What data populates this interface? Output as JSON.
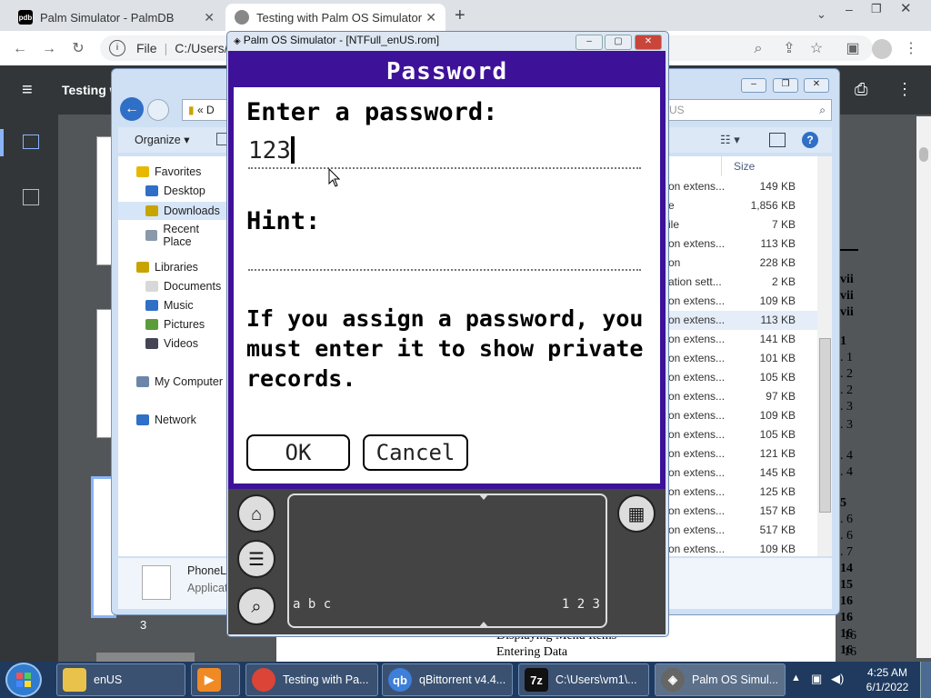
{
  "browser": {
    "tabs": [
      {
        "title": "Palm Simulator - PalmDB",
        "favicon": "pdb"
      },
      {
        "title": "Testing with Palm OS Simulator"
      }
    ],
    "address": {
      "prefix": "File",
      "url": "C:/Users/vm"
    },
    "pdf_title": "Testing w"
  },
  "pdf": {
    "toc_right": [
      "vii",
      "vii",
      "vii",
      "1",
      ". 1",
      ". 2",
      ". 2",
      ". 3",
      ". 3",
      ". 4",
      ". 4",
      "5",
      ". 6",
      ". 6",
      ". 7",
      "14",
      "15",
      "16",
      "16",
      "16",
      "16"
    ],
    "bottom_entries": [
      {
        "label": "Displaying Menu Items",
        "page": "16"
      },
      {
        "label": "Entering Data",
        "page": "16"
      }
    ],
    "thumb_page": "3"
  },
  "explorer": {
    "search_placeholder": "US",
    "crumb": "D",
    "organize": "Organize",
    "column_size": "Size",
    "nav": [
      {
        "label": "Favorites"
      },
      {
        "label": "Desktop"
      },
      {
        "label": "Downloads"
      },
      {
        "label": "Recent Place"
      },
      {
        "label": "Libraries"
      },
      {
        "label": "Documents"
      },
      {
        "label": "Music"
      },
      {
        "label": "Pictures"
      },
      {
        "label": "Videos"
      },
      {
        "label": "My Computer"
      },
      {
        "label": "Network"
      }
    ],
    "rows": [
      {
        "name": "on extens...",
        "size": "149 KB"
      },
      {
        "name": "e",
        "size": "1,856 KB"
      },
      {
        "name": "ile",
        "size": "7 KB"
      },
      {
        "name": "on extens...",
        "size": "113 KB"
      },
      {
        "name": "on",
        "size": "228 KB"
      },
      {
        "name": "ation sett...",
        "size": "2 KB"
      },
      {
        "name": "on extens...",
        "size": "109 KB"
      },
      {
        "name": "on extens...",
        "size": "113 KB"
      },
      {
        "name": "on extens...",
        "size": "141 KB"
      },
      {
        "name": "on extens...",
        "size": "101 KB"
      },
      {
        "name": "on extens...",
        "size": "105 KB"
      },
      {
        "name": "on extens...",
        "size": "97 KB"
      },
      {
        "name": "on extens...",
        "size": "109 KB"
      },
      {
        "name": "on extens...",
        "size": "105 KB"
      },
      {
        "name": "on extens...",
        "size": "121 KB"
      },
      {
        "name": "on extens...",
        "size": "145 KB"
      },
      {
        "name": "on extens...",
        "size": "125 KB"
      },
      {
        "name": "on extens...",
        "size": "157 KB"
      },
      {
        "name": "on extens...",
        "size": "517 KB"
      },
      {
        "name": "on extens...",
        "size": "109 KB"
      }
    ],
    "details": {
      "name": "PhoneL",
      "type": "Applicat"
    }
  },
  "palm": {
    "window_title": "Palm OS Simulator - [NTFull_enUS.rom]",
    "form_title": "Password",
    "prompt": "Enter a password:",
    "password_value": "123",
    "hint_label": "Hint:",
    "hint_value": "",
    "message_lines": [
      "If you assign a password, you",
      "must enter it to show private",
      "records."
    ],
    "ok": "OK",
    "cancel": "Cancel",
    "graffiti_left": "a b c",
    "graffiti_right": "1 2 3"
  },
  "taskbar": {
    "items": [
      {
        "label": "enUS"
      },
      {
        "label": ""
      },
      {
        "label": "Testing with Pa..."
      },
      {
        "label": "qBittorrent v4.4..."
      },
      {
        "label": "C:\\Users\\vm1\\..."
      },
      {
        "label": "Palm OS Simul..."
      }
    ],
    "time": "4:25 AM",
    "date": "6/1/2022"
  },
  "colors": {
    "palm_accent": "#3d1299",
    "taskbar": "#1f3a5e"
  }
}
